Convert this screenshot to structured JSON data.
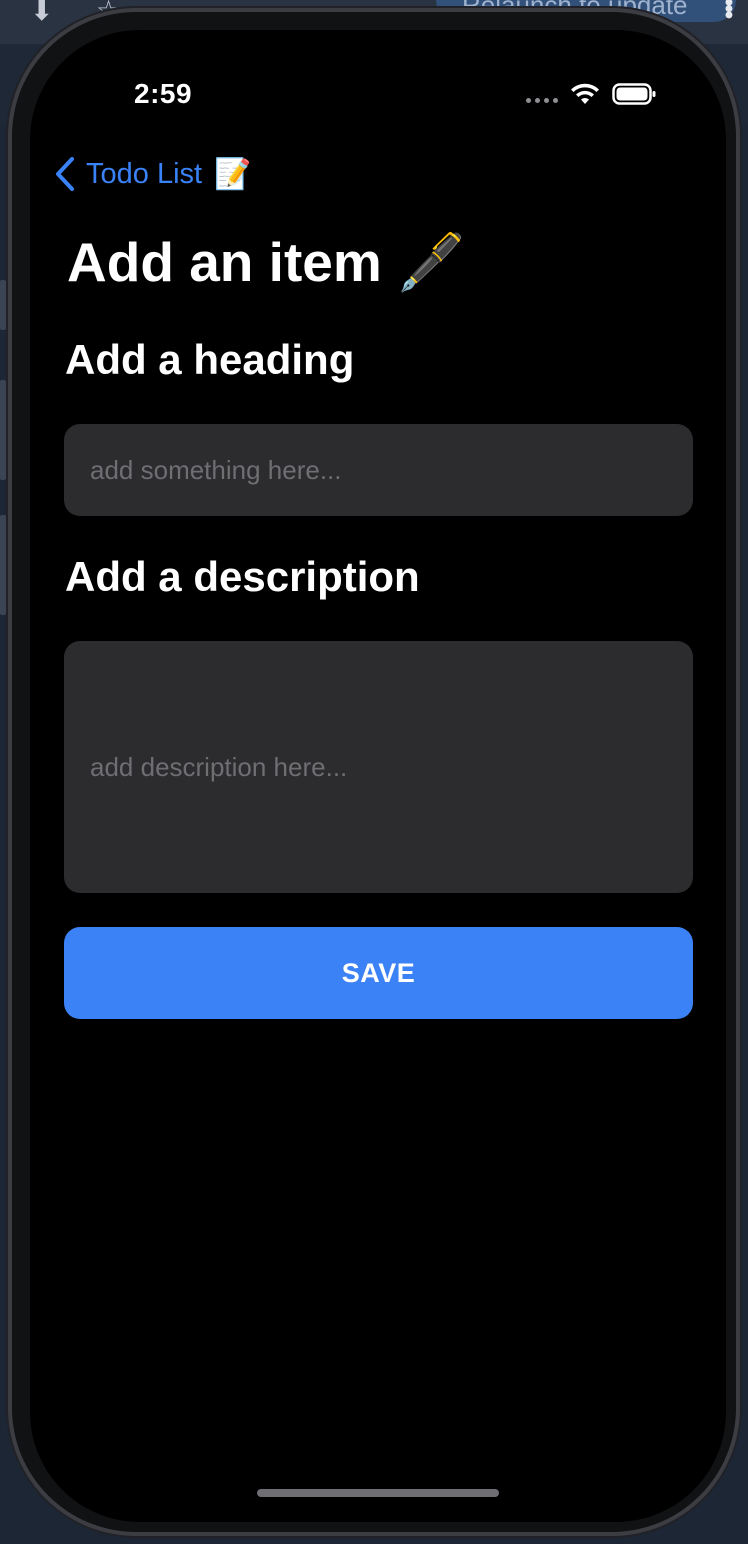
{
  "host": {
    "relaunch_label": "Relaunch to update"
  },
  "status_bar": {
    "time": "2:59"
  },
  "nav": {
    "back_label": "Todo List",
    "back_emoji": "📝"
  },
  "page": {
    "title": "Add an item 🖋️"
  },
  "form": {
    "heading_label": "Add a heading",
    "heading_placeholder": "add something here...",
    "description_label": "Add a description",
    "description_placeholder": "add description here...",
    "save_label": "SAVE"
  },
  "colors": {
    "accent": "#3a82f7",
    "button": "#3b82f6",
    "field_background": "#2c2c2e",
    "screen_background": "#000000"
  }
}
